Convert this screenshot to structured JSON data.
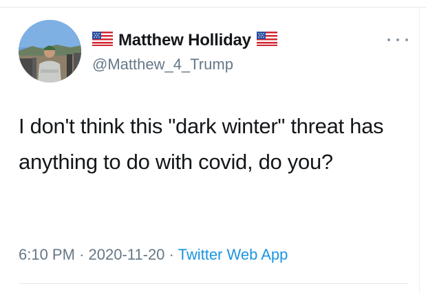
{
  "user": {
    "display_name": "Matthew Holliday",
    "handle": "@Matthew_4_Trump"
  },
  "tweet": {
    "text": "I don't think this \"dark winter\" threat has anything to do with covid, do you?",
    "time": "6:10 PM",
    "separator": "·",
    "date": "2020-11-20",
    "source": "Twitter Web App"
  },
  "icons": {
    "name_prefix": "us-flag-icon",
    "name_suffix": "us-flag-icon",
    "more": "more-options-icon"
  },
  "colors": {
    "name": "#14171a",
    "secondary": "#657786",
    "link": "#1b95e0"
  }
}
